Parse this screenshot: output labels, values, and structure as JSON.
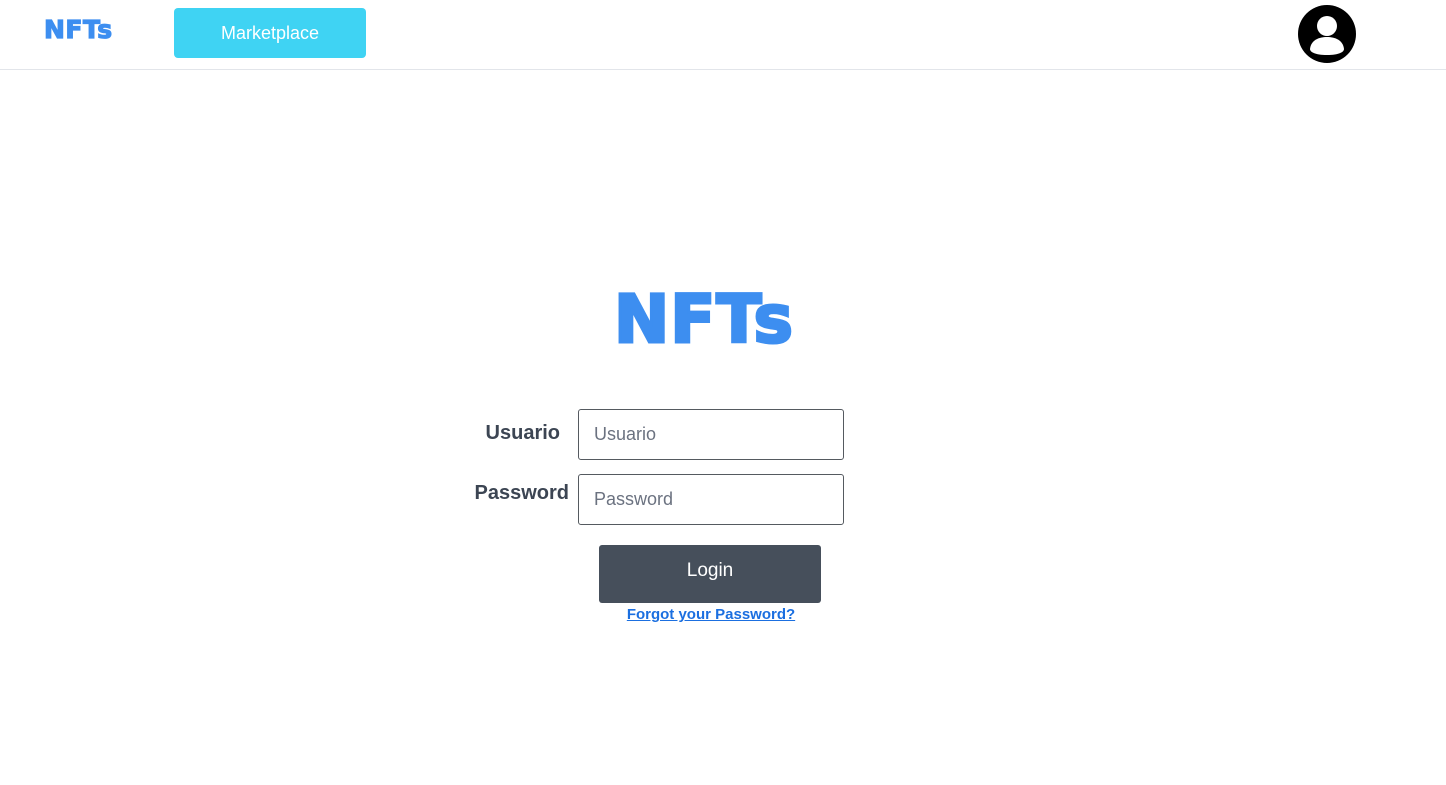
{
  "navbar": {
    "logo_text": "NFTs",
    "marketplace_label": "Marketplace",
    "avatar_icon": "user-circle-icon"
  },
  "login": {
    "logo_text": "NFTs",
    "username_label": "Usuario",
    "username_placeholder": "Usuario",
    "username_value": "",
    "password_label": "Password",
    "password_placeholder": "Password",
    "password_value": "",
    "submit_label": "Login",
    "forgot_link": "Forgot your Password?"
  },
  "colors": {
    "brand_blue": "#3d8ef0",
    "marketplace_button": "#3fd3f3",
    "login_button": "#464f5b",
    "link": "#1b6fe0",
    "label_text": "#3c4553"
  }
}
